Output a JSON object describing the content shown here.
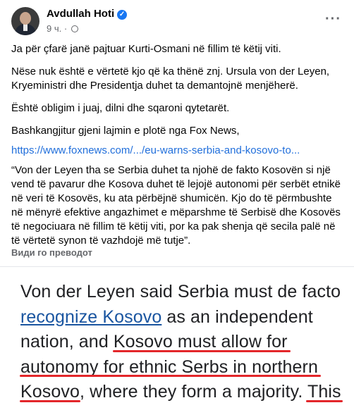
{
  "post": {
    "author": "Avdullah Hoti",
    "time": "9 ч.",
    "more_icon": "more-icon",
    "paragraphs": [
      "Ja për çfarë janë pajtuar Kurti-Osmani në fillim të këtij viti.",
      "Nëse nuk është e vërtetë kjo që ka thënë znj. Ursula von der Leyen, Kryeministri dhe Presidentja duhet ta demantojnë menjëherë.",
      "Është obligim i juaj, dilni dhe sqaroni qytetarët.",
      "Bashkangjitur gjeni lajmin e plotë nga Fox News,"
    ],
    "link": "https://www.foxnews.com/.../eu-warns-serbia-and-kosovo-to...",
    "quote": "“Von der Leyen tha se Serbia duhet ta njohë de fakto Kosovën si një vend të pavarur dhe Kosova duhet të lejojë autonomi për serbët etnikë në veri të Kosovës, ku ata përbëjnë shumicën. Kjo do të përmbushte në mënyrë efektive angazhimet e mëparshme të Serbisë dhe Kosovës të negociuara në fillim të këtij viti, por ka pak shenja që secila palë në të vërtetë synon të vazhdojë më tutje”.",
    "translate": "Види го преводот"
  },
  "photo": {
    "part1": "Von der Leyen said Serbia must de facto ",
    "part2": "recognize Kosovo",
    "part3": " as an independent nation, and Kosovo must allow for autonomy for ethnic Serbs in northern Kosovo, where they form a majority. This would effectively fulfill Serbia and"
  }
}
